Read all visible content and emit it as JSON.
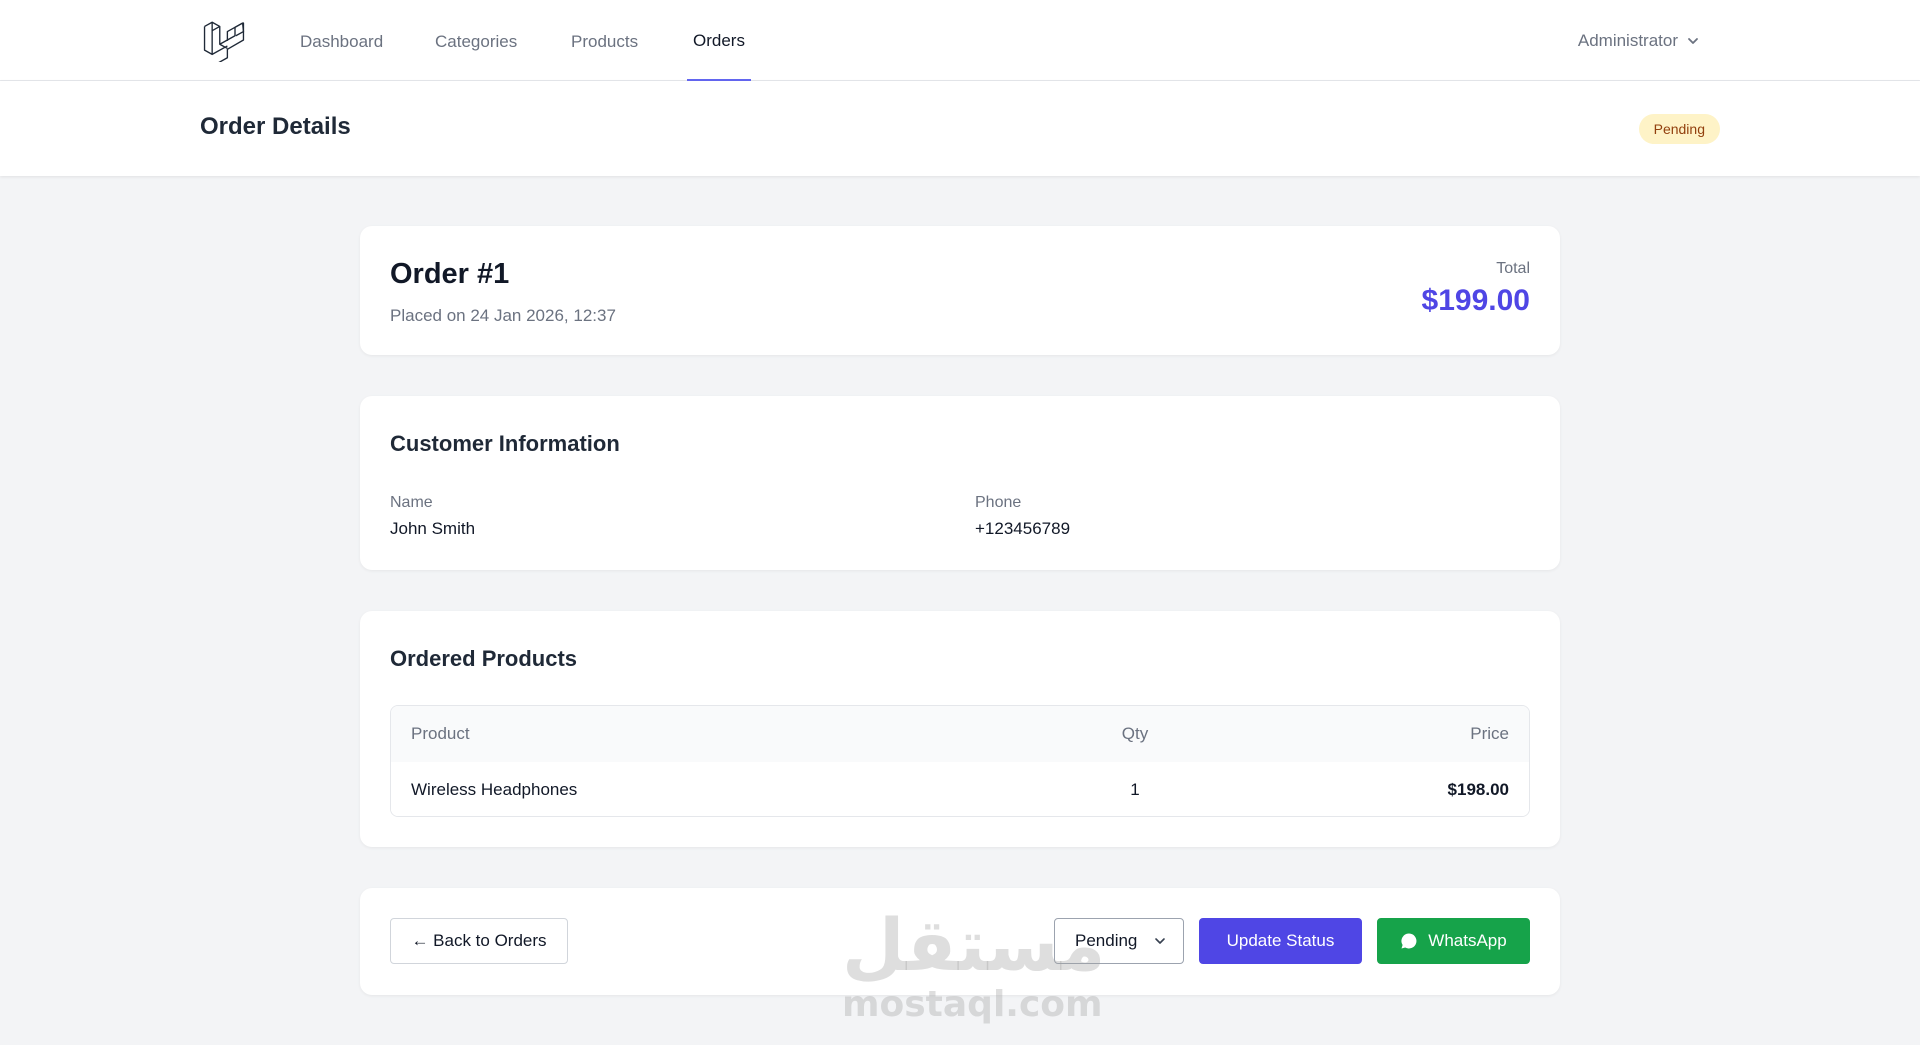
{
  "nav": {
    "items": [
      {
        "label": "Dashboard",
        "active": false
      },
      {
        "label": "Categories",
        "active": false
      },
      {
        "label": "Products",
        "active": false
      },
      {
        "label": "Orders",
        "active": true
      }
    ],
    "user": "Administrator"
  },
  "header": {
    "title": "Order Details",
    "status": "Pending"
  },
  "order": {
    "title": "Order #1",
    "placed": "Placed on 24 Jan 2026, 12:37",
    "total_label": "Total",
    "total": "$199.00"
  },
  "customer": {
    "section_title": "Customer Information",
    "name_label": "Name",
    "name": "John Smith",
    "phone_label": "Phone",
    "phone": "+123456789"
  },
  "products": {
    "section_title": "Ordered Products",
    "columns": [
      "Product",
      "Qty",
      "Price"
    ],
    "rows": [
      {
        "product": "Wireless Headphones",
        "qty": "1",
        "price": "$198.00"
      }
    ]
  },
  "actions": {
    "back_label": "← Back to Orders",
    "status_value": "Pending",
    "update_label": "Update Status",
    "whatsapp_label": "WhatsApp"
  },
  "watermark": {
    "arabic": "مستقل",
    "latin": "mostaql.com"
  },
  "colors": {
    "accent": "#4f46e5",
    "whatsapp": "#16a34a",
    "badge_bg": "#fef3c7",
    "badge_text": "#92400e"
  },
  "icons": [
    "laravel-logo-icon",
    "chevron-down-icon",
    "whatsapp-icon"
  ]
}
